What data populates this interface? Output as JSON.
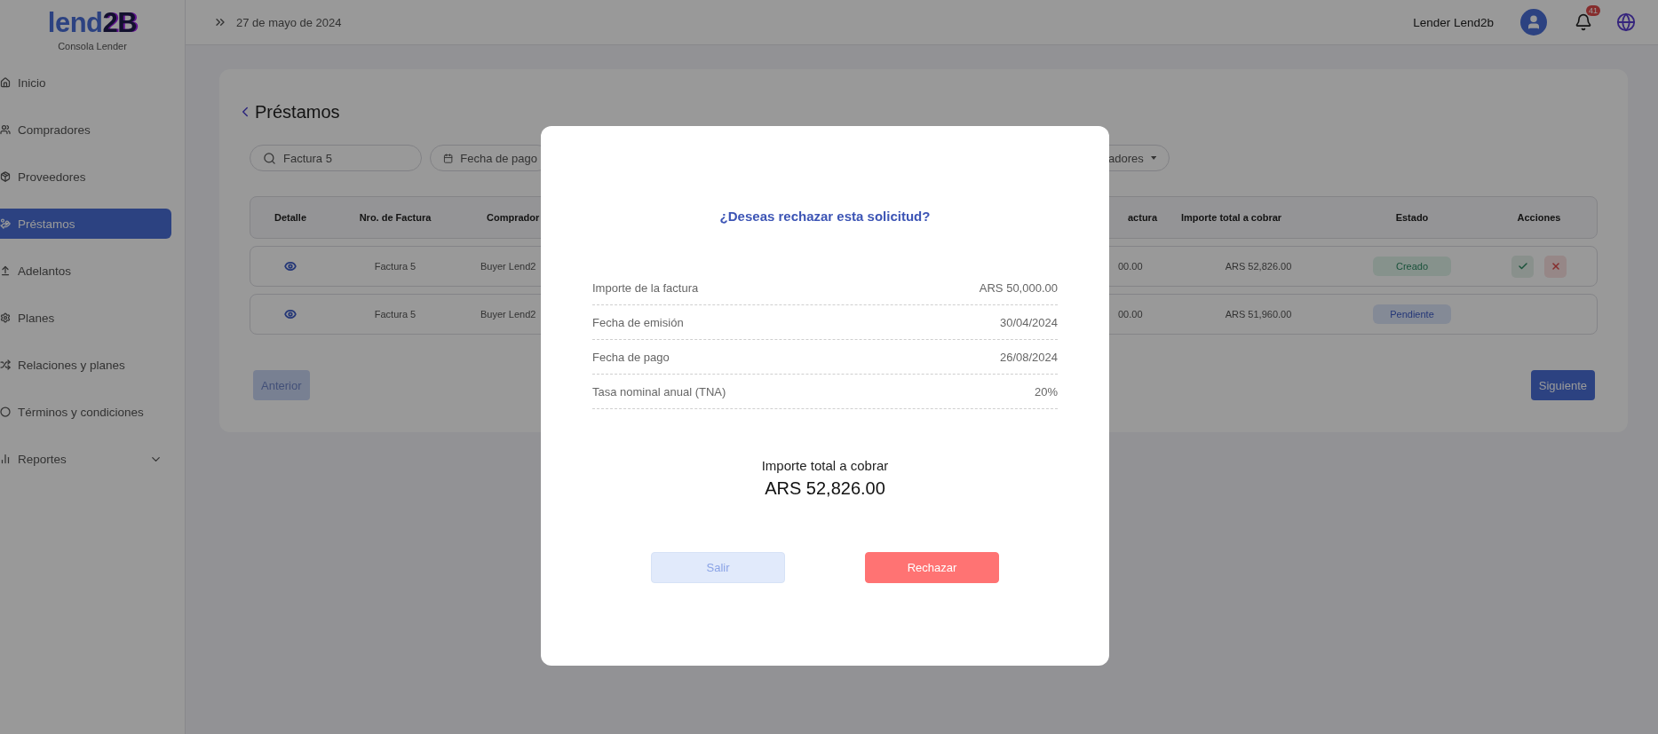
{
  "sidebar": {
    "logo": {
      "light": "lend",
      "dark": "2B"
    },
    "subtitle": "Consola Lender",
    "items": [
      {
        "label": "Inicio",
        "kind": "home",
        "selected": false
      },
      {
        "label": "Compradores",
        "kind": "users",
        "selected": false
      },
      {
        "label": "Proveedores",
        "kind": "box",
        "selected": false
      },
      {
        "label": "Préstamos",
        "kind": "loan",
        "selected": true
      },
      {
        "label": "Adelantos",
        "kind": "advance",
        "selected": false
      },
      {
        "label": "Planes",
        "kind": "gear",
        "selected": false
      },
      {
        "label": "Relaciones y planes",
        "kind": "shuffle",
        "selected": false
      },
      {
        "label": "Términos y condiciones",
        "kind": "circle",
        "selected": false
      },
      {
        "label": "Reportes",
        "kind": "group",
        "selected": false
      }
    ]
  },
  "topbar": {
    "date": "27 de mayo de 2024",
    "user": "Lender Lend2b",
    "notifications": "41"
  },
  "page": {
    "title": "Préstamos",
    "search": {
      "value": "Factura 5"
    },
    "filters": [
      {
        "kind": "date",
        "label": "Fecha de pago"
      },
      {
        "kind": "dropdown",
        "label": "adores"
      }
    ]
  },
  "table": {
    "columns": [
      "Detalle",
      "Nro. de Factura",
      "Comprador",
      "actura",
      "Importe total a cobrar",
      "Estado",
      "Acciones"
    ],
    "rows": [
      {
        "invoice": "Factura 5",
        "buyer": "Buyer Lend2",
        "column_4": "00.00",
        "total": "ARS 52,826.00",
        "status": {
          "label": "Creado",
          "kind": "created"
        },
        "has_actions": true
      },
      {
        "invoice": "Factura 5",
        "buyer": "Buyer Lend2",
        "column_4": "00.00",
        "total": "ARS 51,960.00",
        "status": {
          "label": "Pendiente",
          "kind": "pending"
        },
        "has_actions": false
      }
    ]
  },
  "pagination": {
    "previous": {
      "label": "Anterior",
      "disabled": true
    },
    "next": {
      "label": "Siguiente",
      "disabled": false
    }
  },
  "modal": {
    "title": "¿Deseas rechazar esta solicitud?",
    "details": [
      {
        "label": "Importe de la factura",
        "value": "ARS 50,000.00"
      },
      {
        "label": "Fecha de emisión",
        "value": "30/04/2024"
      },
      {
        "label": "Fecha de pago",
        "value": "26/08/2024"
      },
      {
        "label": "Tasa nominal anual (TNA)",
        "value": "20%"
      }
    ],
    "total_label": "Importe total a cobrar",
    "total_value": "ARS 52,826.00",
    "cancel": "Salir",
    "confirm": "Rechazar"
  }
}
